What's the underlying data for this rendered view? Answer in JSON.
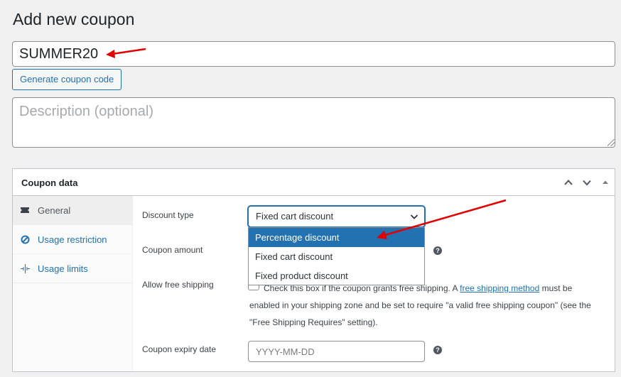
{
  "page": {
    "title": "Add new coupon"
  },
  "coupon_code": {
    "value": "SUMMER20"
  },
  "generate_button": {
    "label": "Generate coupon code"
  },
  "description": {
    "placeholder": "Description (optional)",
    "value": ""
  },
  "coupon_data": {
    "title": "Coupon data",
    "tabs": [
      {
        "label": "General",
        "icon": "ticket-icon",
        "active": true
      },
      {
        "label": "Usage restriction",
        "icon": "block-icon",
        "active": false
      },
      {
        "label": "Usage limits",
        "icon": "crosshair-icon",
        "active": false
      }
    ],
    "discount_type": {
      "label": "Discount type",
      "selected": "Fixed cart discount",
      "options": [
        "Percentage discount",
        "Fixed cart discount",
        "Fixed product discount"
      ],
      "highlighted": "Percentage discount"
    },
    "coupon_amount": {
      "label": "Coupon amount"
    },
    "free_shipping": {
      "label": "Allow free shipping",
      "desc_before": "Check this box if the coupon grants free shipping. A ",
      "link": "free shipping method",
      "desc_after": " must be enabled in your shipping zone and be set to require \"a valid free shipping coupon\" (see the \"Free Shipping Requires\" setting).",
      "checked": false
    },
    "expiry_date": {
      "label": "Coupon expiry date",
      "placeholder": "YYYY-MM-DD"
    }
  },
  "colors": {
    "accent": "#2271b1",
    "annotation": "#e00000"
  }
}
